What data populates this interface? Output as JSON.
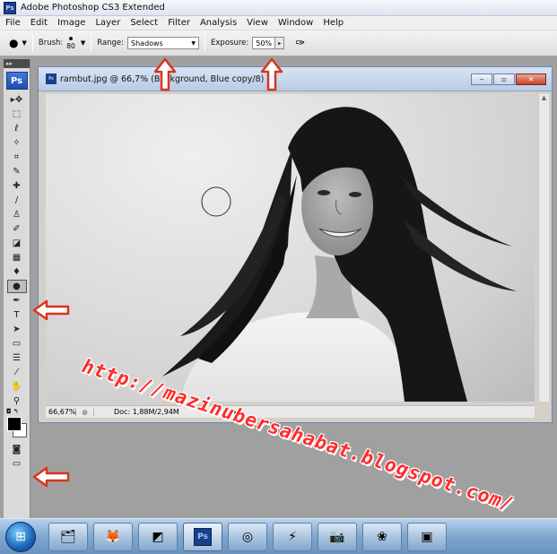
{
  "app": {
    "title": "Adobe Photoshop CS3 Extended",
    "badge": "Ps"
  },
  "menu": [
    "File",
    "Edit",
    "Image",
    "Layer",
    "Select",
    "Filter",
    "Analysis",
    "View",
    "Window",
    "Help"
  ],
  "options": {
    "brush_label": "Brush:",
    "brush_size": "80",
    "range_label": "Range:",
    "range_value": "Shadows",
    "exposure_label": "Exposure:",
    "exposure_value": "50%"
  },
  "toolbox": {
    "logo": "Ps",
    "tools": [
      {
        "name": "move-tool",
        "glyph": "▸✥"
      },
      {
        "name": "marquee-tool",
        "glyph": "⬚"
      },
      {
        "name": "lasso-tool",
        "glyph": "ℓ"
      },
      {
        "name": "magic-wand-tool",
        "glyph": "✧"
      },
      {
        "name": "crop-tool",
        "glyph": "⌗"
      },
      {
        "name": "slice-tool",
        "glyph": "✎"
      },
      {
        "name": "healing-brush-tool",
        "glyph": "✚"
      },
      {
        "name": "brush-tool",
        "glyph": "/"
      },
      {
        "name": "clone-stamp-tool",
        "glyph": "♙"
      },
      {
        "name": "history-brush-tool",
        "glyph": "✐"
      },
      {
        "name": "eraser-tool",
        "glyph": "◪"
      },
      {
        "name": "gradient-tool",
        "glyph": "▦"
      },
      {
        "name": "blur-tool",
        "glyph": "♦"
      },
      {
        "name": "burn-tool",
        "glyph": "●"
      },
      {
        "name": "pen-tool",
        "glyph": "✒"
      },
      {
        "name": "type-tool",
        "glyph": "T"
      },
      {
        "name": "path-selection-tool",
        "glyph": "➤"
      },
      {
        "name": "shape-tool",
        "glyph": "▭"
      },
      {
        "name": "notes-tool",
        "glyph": "☰"
      },
      {
        "name": "eyedropper-tool",
        "glyph": "⁄"
      },
      {
        "name": "hand-tool",
        "glyph": "✋"
      },
      {
        "name": "zoom-tool",
        "glyph": "⚲"
      }
    ],
    "active_tool": "burn-tool"
  },
  "document": {
    "badge": "Ps",
    "title": "rambut.jpg @ 66,7% (Background, Blue copy/8)",
    "zoom": "66,67%",
    "doc_size": "Doc: 1,88M/2,94M"
  },
  "watermark": "http://mazinubersahabat.blogspot.com/",
  "taskbar": {
    "ps_label": "Ps",
    "items": [
      {
        "name": "explorer-icon",
        "glyph": "🗂"
      },
      {
        "name": "firefox-icon",
        "glyph": "🦊"
      },
      {
        "name": "notes-app-icon",
        "glyph": "◩"
      },
      {
        "name": "photoshop-icon",
        "glyph": "Ps"
      },
      {
        "name": "chrome-icon",
        "glyph": "◎"
      },
      {
        "name": "transfer-app-icon",
        "glyph": "⚡"
      },
      {
        "name": "camera-app-icon",
        "glyph": "📷"
      },
      {
        "name": "network-app-icon",
        "glyph": "❀"
      },
      {
        "name": "media-app-icon",
        "glyph": "▣"
      }
    ]
  },
  "colors": {
    "arrow_red": "#d9341e",
    "watermark_red": "#ff2b2b",
    "foreground": "#000000",
    "background": "#ffffff"
  }
}
